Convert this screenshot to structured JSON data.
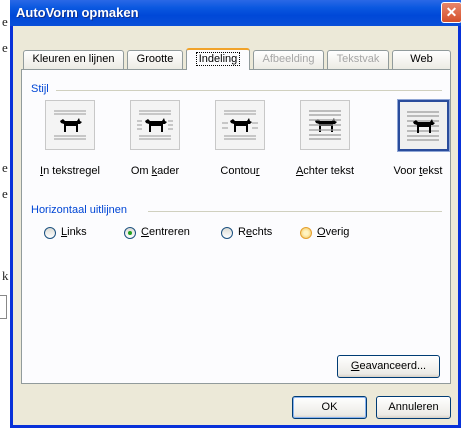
{
  "window": {
    "title": "AutoVorm opmaken"
  },
  "tabs": [
    {
      "label": "Kleuren en lijnen",
      "state": "normal"
    },
    {
      "label": "Grootte",
      "state": "normal"
    },
    {
      "label": "Indeling",
      "state": "active"
    },
    {
      "label": "Afbeelding",
      "state": "disabled"
    },
    {
      "label": "Tekstvak",
      "state": "disabled"
    },
    {
      "label": "Web",
      "state": "normal"
    }
  ],
  "style_group": {
    "label": "Stijl",
    "options": [
      {
        "label_pre": "",
        "mnemonic": "I",
        "label_post": "n tekstregel",
        "icon": "inline-with-text-icon"
      },
      {
        "label_pre": "Om ",
        "mnemonic": "k",
        "label_post": "ader",
        "icon": "square-wrap-icon"
      },
      {
        "label_pre": "Contou",
        "mnemonic": "r",
        "label_post": "",
        "icon": "tight-wrap-icon"
      },
      {
        "label_pre": "",
        "mnemonic": "A",
        "label_post": "chter tekst",
        "icon": "behind-text-icon"
      },
      {
        "label_pre": "Voor ",
        "mnemonic": "t",
        "label_post": "ekst",
        "icon": "in-front-of-text-icon",
        "selected": true
      }
    ]
  },
  "align_group": {
    "label": "Horizontaal uitlijnen",
    "options": [
      {
        "mnemonic": "L",
        "label_post": "inks",
        "checked": false
      },
      {
        "mnemonic": "C",
        "label_post": "entreren",
        "checked": true
      },
      {
        "label_pre": "R",
        "mnemonic": "e",
        "label_post": "chts",
        "checked": false
      },
      {
        "mnemonic": "O",
        "label_post": "verig",
        "checked": false
      }
    ]
  },
  "buttons": {
    "advanced": {
      "mnemonic": "G",
      "label_post": "eavanceerd..."
    },
    "ok": "OK",
    "cancel": "Annuleren"
  },
  "background_doc": {
    "letters": [
      "e",
      "e",
      "e",
      "e",
      "k"
    ]
  },
  "colors": {
    "titlebar": "#0a58e0",
    "group_label": "#0046d5",
    "close": "#d4502c"
  }
}
